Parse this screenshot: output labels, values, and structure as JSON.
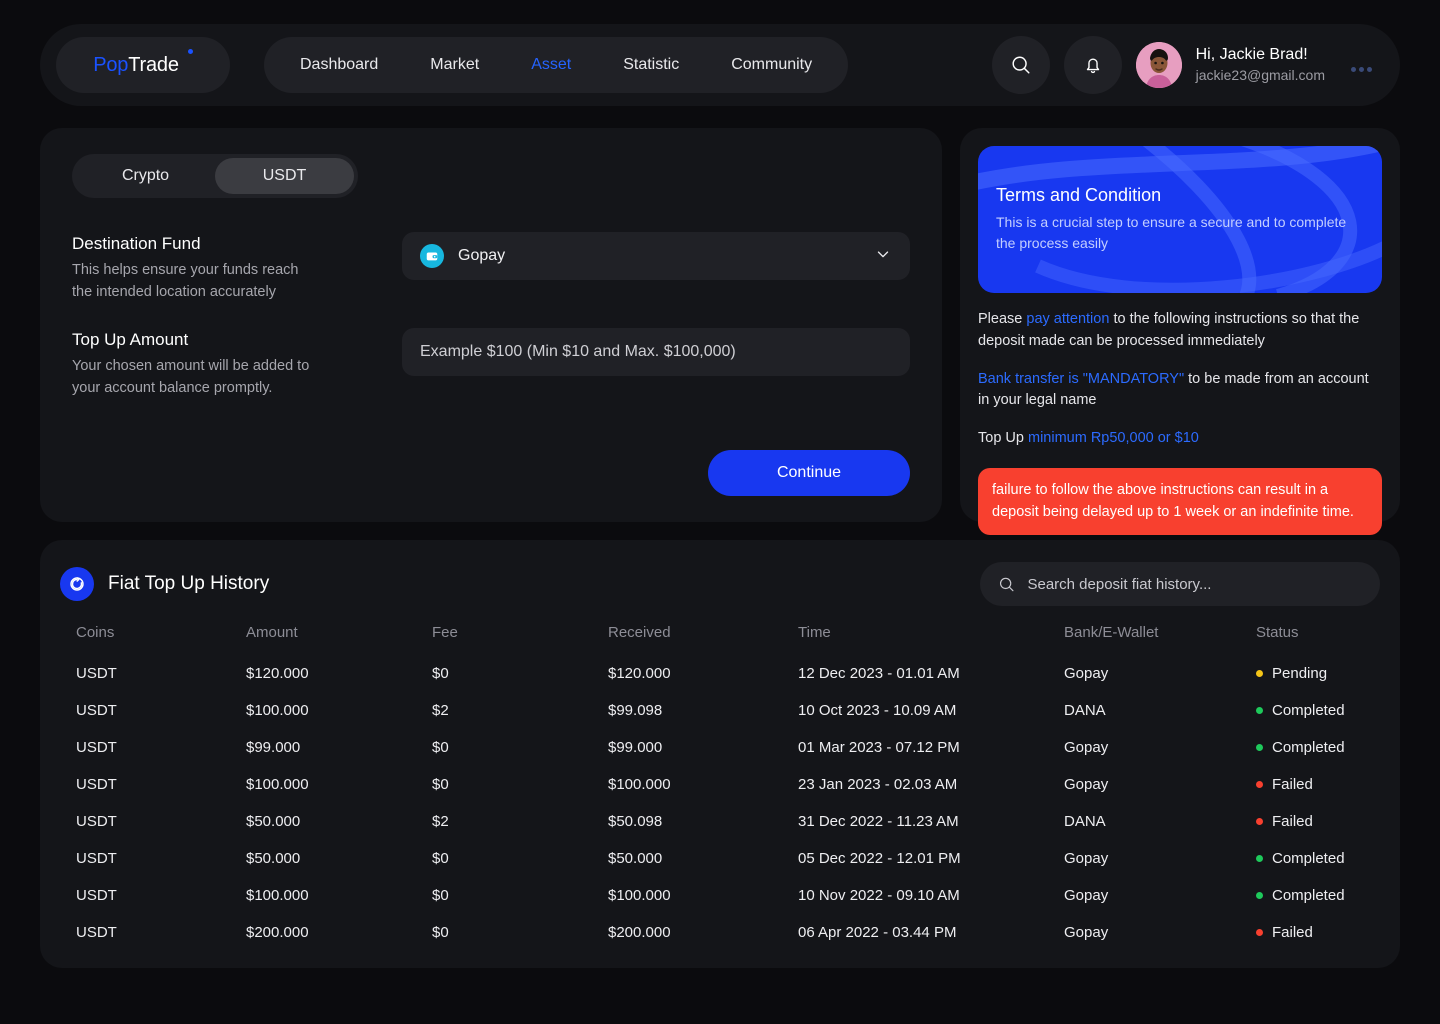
{
  "header": {
    "logo": {
      "part1": "Pop",
      "part2": "Trade"
    },
    "nav": [
      {
        "label": "Dashboard",
        "active": false
      },
      {
        "label": "Market",
        "active": false
      },
      {
        "label": "Asset",
        "active": true
      },
      {
        "label": "Statistic",
        "active": false
      },
      {
        "label": "Community",
        "active": false
      }
    ],
    "search_icon": "search-icon",
    "bell_icon": "bell-icon",
    "user": {
      "greeting": "Hi, Jackie Brad!",
      "email": "jackie23@gmail.com"
    }
  },
  "topup": {
    "tabs": [
      {
        "label": "Crypto",
        "active": false
      },
      {
        "label": "USDT",
        "active": true
      }
    ],
    "destination": {
      "title": "Destination Fund",
      "description": "This helps ensure your funds reach the intended location accurately",
      "selected": "Gopay",
      "icon": "wallet-icon"
    },
    "amount": {
      "title": "Top Up Amount",
      "description": "Your chosen amount will be added to your account balance promptly.",
      "value": "",
      "placeholder": "Example $100 (Min $10 and Max. $100,000)"
    },
    "continue_label": "Continue"
  },
  "terms": {
    "banner_title": "Terms and Condition",
    "banner_sub": "This is a crucial step to ensure a secure and to complete the process easily",
    "line1_a": "Please ",
    "line1_link": "pay attention",
    "line1_b": " to the following instructions so that the deposit made can be processed immediately",
    "line2_link": "Bank transfer is \"MANDATORY\"",
    "line2_b": " to be made from an account in your legal name",
    "line3_a": "Top Up ",
    "line3_link": "minimum Rp50,000 or $10",
    "warning": "failure to follow the above instructions can result in a deposit being delayed up to 1 week or an indefinite time."
  },
  "history": {
    "title": "Fiat Top Up History",
    "icon": "history-refresh-icon",
    "search_placeholder": "Search deposit fiat history...",
    "search_value": "",
    "columns": [
      "Coins",
      "Amount",
      "Fee",
      "Received",
      "Time",
      "Bank/E-Wallet",
      "Status"
    ],
    "status_colors": {
      "Pending": "#f5c518",
      "Completed": "#1ec95b",
      "Failed": "#f8402f"
    },
    "rows": [
      {
        "coin": "USDT",
        "amount": "$120.000",
        "fee": "$0",
        "received": "$120.000",
        "time": "12 Dec 2023 - 01.01 AM",
        "bank": "Gopay",
        "status": "Pending"
      },
      {
        "coin": "USDT",
        "amount": "$100.000",
        "fee": "$2",
        "received": "$99.098",
        "time": "10 Oct 2023 - 10.09 AM",
        "bank": "DANA",
        "status": "Completed"
      },
      {
        "coin": "USDT",
        "amount": "$99.000",
        "fee": "$0",
        "received": "$99.000",
        "time": "01 Mar 2023 - 07.12 PM",
        "bank": "Gopay",
        "status": "Completed"
      },
      {
        "coin": "USDT",
        "amount": "$100.000",
        "fee": "$0",
        "received": "$100.000",
        "time": "23 Jan 2023 - 02.03 AM",
        "bank": "Gopay",
        "status": "Failed"
      },
      {
        "coin": "USDT",
        "amount": "$50.000",
        "fee": "$2",
        "received": "$50.098",
        "time": "31 Dec 2022 - 11.23 AM",
        "bank": "DANA",
        "status": "Failed"
      },
      {
        "coin": "USDT",
        "amount": "$50.000",
        "fee": "$0",
        "received": "$50.000",
        "time": "05 Dec 2022 - 12.01 PM",
        "bank": "Gopay",
        "status": "Completed"
      },
      {
        "coin": "USDT",
        "amount": "$100.000",
        "fee": "$0",
        "received": "$100.000",
        "time": "10 Nov 2022 - 09.10 AM",
        "bank": "Gopay",
        "status": "Completed"
      },
      {
        "coin": "USDT",
        "amount": "$200.000",
        "fee": "$0",
        "received": "$200.000",
        "time": "06 Apr 2022 - 03.44 PM",
        "bank": "Gopay",
        "status": "Failed"
      }
    ]
  },
  "theme": {
    "bg": "#0b0b0e",
    "panel": "#141519",
    "pill": "#202126",
    "accent_blue": "#1838f0",
    "link_blue": "#2c6bff",
    "danger": "#f8402f",
    "cyan": "#17b7df"
  }
}
